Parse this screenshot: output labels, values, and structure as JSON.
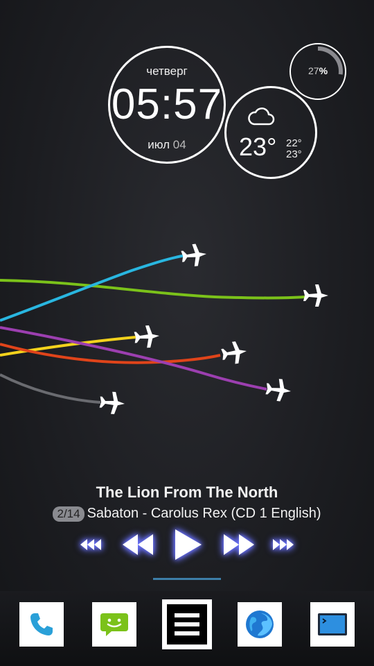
{
  "clock": {
    "day": "четверг",
    "time": "05:57",
    "month": "июл",
    "date": "04"
  },
  "weather": {
    "icon": "cloud-icon",
    "temp": "23°",
    "high": "22°",
    "low": "23°"
  },
  "battery": {
    "percent_value": "27",
    "percent_sign": "%",
    "level": 0.27
  },
  "music": {
    "title": "The Lion From The North",
    "track_position": "2/14",
    "artist_album": "Sabaton - Carolus Rex (CD 1 English)"
  },
  "wallpaper": {
    "trail_colors": [
      "#29b6e0",
      "#7bc21a",
      "#f3d21c",
      "#e0441a",
      "#9c3fb0",
      "#6a6b70"
    ]
  },
  "controls": {
    "icons": [
      "skip-back-icon",
      "rewind-icon",
      "play-icon",
      "fast-forward-icon",
      "skip-forward-icon"
    ],
    "glow_color": "#6a72ff"
  },
  "dock": {
    "icons": [
      "phone-icon",
      "messaging-icon",
      "app-drawer-icon",
      "browser-icon",
      "terminal-icon"
    ]
  }
}
